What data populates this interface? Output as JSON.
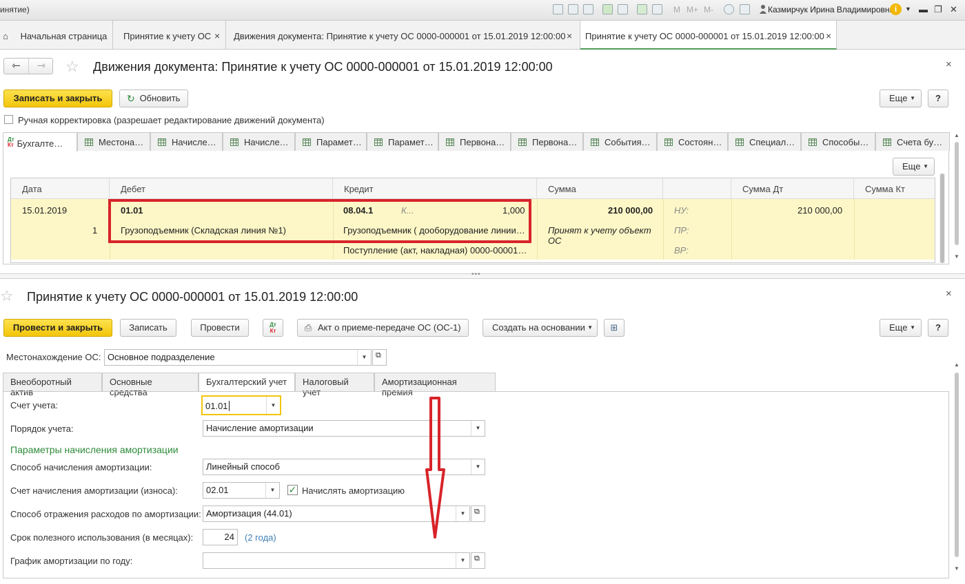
{
  "app": {
    "title_fragment": "инятие)",
    "user": "Казмирчук Ирина Владимировна",
    "m_buttons": [
      "M",
      "M+",
      "M-"
    ]
  },
  "window_tabs": [
    {
      "label": "Начальная страница"
    },
    {
      "label": "Принятие к учету ОС"
    },
    {
      "label": "Движения документа: Принятие к учету ОС 0000-000001 от 15.01.2019 12:00:00"
    },
    {
      "label": "Принятие к учету ОС 0000-000001 от 15.01.2019 12:00:00"
    }
  ],
  "movements": {
    "title": "Движения документа: Принятие к учету ОС 0000-000001 от 15.01.2019 12:00:00",
    "save_close": "Записать и закрыть",
    "refresh": "Обновить",
    "more": "Еще",
    "help": "?",
    "manual_edit": "Ручная корректировка (разрешает редактирование движений документа)",
    "subtabs": [
      "Бухгалте…",
      "Местона…",
      "Начисле…",
      "Начисле…",
      "Парамет…",
      "Парамет…",
      "Первона…",
      "Первона…",
      "События…",
      "Состоян…",
      "Специал…",
      "Способы…",
      "Счета бу…"
    ],
    "table_more": "Еще",
    "columns": [
      "Дата",
      "Дебет",
      "Кредит",
      "Сумма",
      "",
      "Сумма Дт",
      "Сумма Кт"
    ],
    "row": {
      "date": "15.01.2019",
      "num": "1",
      "debit_account": "01.01",
      "debit_sub": "Грузоподъемник (Складская линия №1)",
      "credit_account": "08.04.1",
      "credit_k": "К...",
      "credit_qty": "1,000",
      "credit_sub1": "Грузоподъемник ( дооборудование линии…",
      "credit_sub2": "Поступление (акт, накладная) 0000-00001…",
      "sum": "210 000,00",
      "content": "Принят к учету объект ОС",
      "nu": "НУ:",
      "pr": "ПР:",
      "vr": "ВР:",
      "sum_dt": "210 000,00"
    }
  },
  "document": {
    "title": "Принятие к учету ОС 0000-000001 от 15.01.2019 12:00:00",
    "post_close": "Провести и закрыть",
    "save": "Записать",
    "post": "Провести",
    "act": "Акт о приеме-передаче ОС (ОС-1)",
    "create_based": "Создать на основании",
    "more": "Еще",
    "help": "?",
    "location_label": "Местонахождение ОС:",
    "location_value": "Основное подразделение",
    "tabs": [
      "Внеоборотный актив",
      "Основные средства",
      "Бухгалтерский учет",
      "Налоговый учет",
      "Амортизационная премия"
    ],
    "account_label": "Счет учета:",
    "account_value": "01.01",
    "order_label": "Порядок учета:",
    "order_value": "Начисление амортизации",
    "section_title": "Параметры начисления амортизации",
    "method_label": "Способ начисления амортизации:",
    "method_value": "Линейный способ",
    "dep_account_label": "Счет начисления амортизации (износа):",
    "dep_account_value": "02.01",
    "charge_dep": "Начислять амортизацию",
    "expense_label": "Способ отражения расходов по амортизации:",
    "expense_value": "Амортизация (44.01)",
    "term_label": "Срок полезного использования (в месяцах):",
    "term_value": "24",
    "term_hint": "(2 года)",
    "schedule_label": "График амортизации по году:",
    "schedule_value": ""
  },
  "colors": {
    "accent_yellow": "#f5c81a",
    "highlight_red": "#d8232a",
    "row_yellow": "#fdf7c7",
    "section_green": "#2e8b3a"
  }
}
